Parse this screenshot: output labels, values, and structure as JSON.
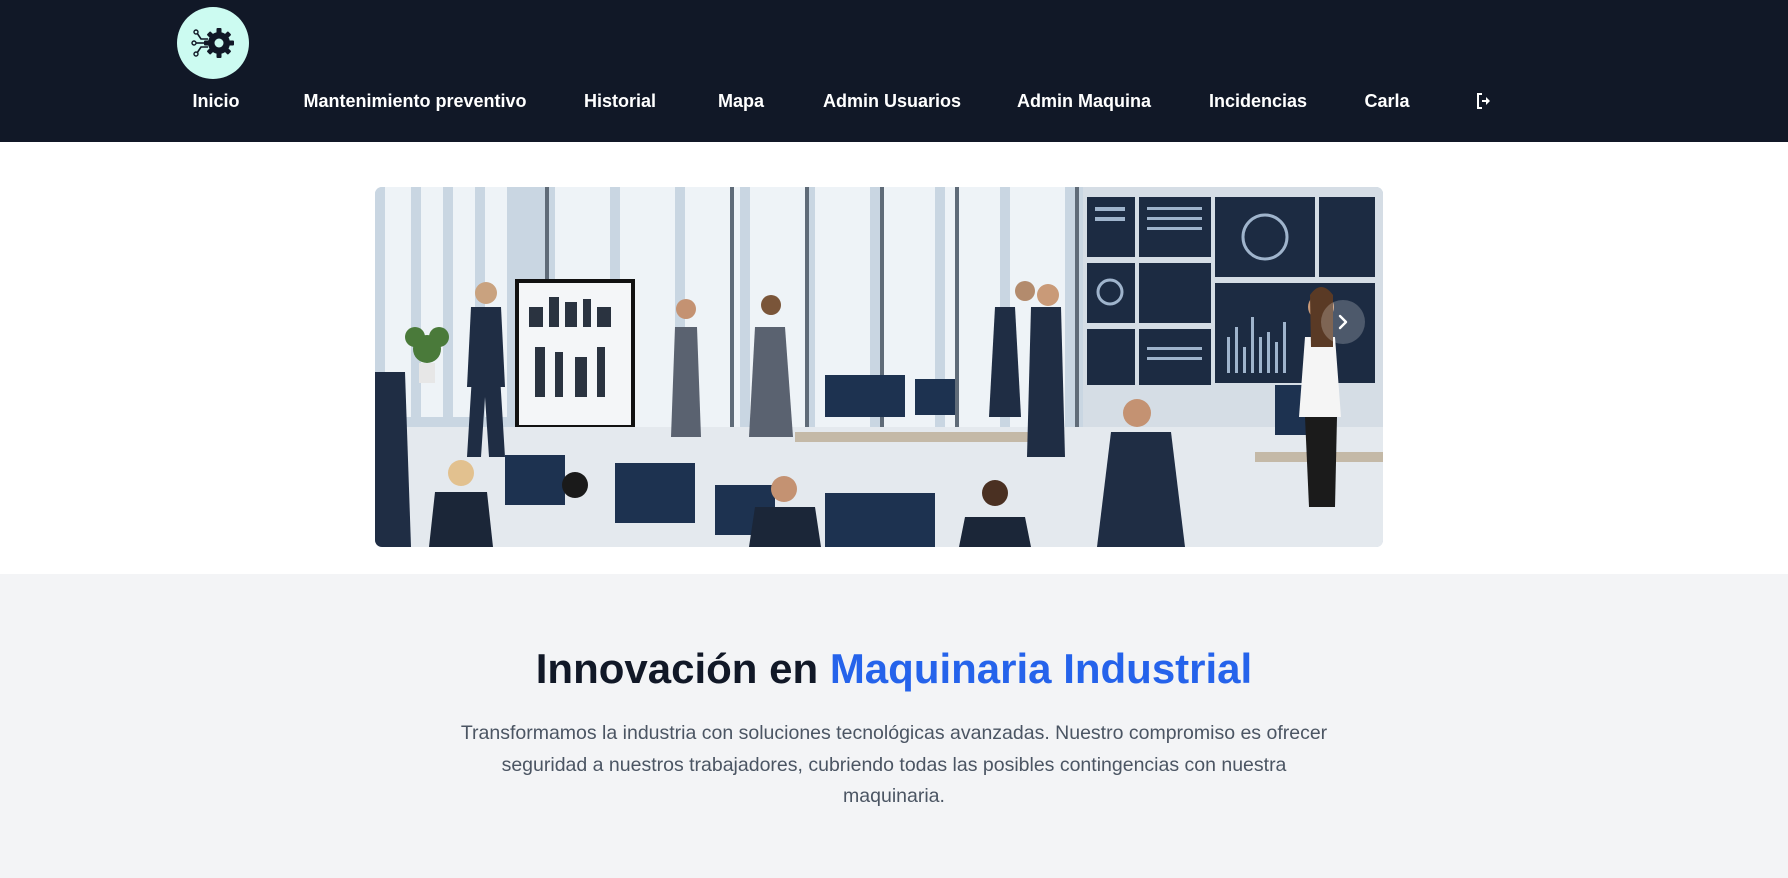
{
  "nav": {
    "items": [
      {
        "label": "Inicio"
      },
      {
        "label": "Mantenimiento preventivo"
      },
      {
        "label": "Historial"
      },
      {
        "label": "Mapa"
      },
      {
        "label": "Admin Usuarios"
      },
      {
        "label": "Admin Maquina"
      },
      {
        "label": "Incidencias"
      },
      {
        "label": "Carla"
      }
    ],
    "logo_icon": "gear-circuit-icon",
    "logout_icon": "logout-icon"
  },
  "carousel": {
    "image": "office-team-monitoring-dashboards-image",
    "next_icon": "chevron-right-icon"
  },
  "intro": {
    "title_part1": "Innovación en ",
    "title_accent": "Maquinaria Industrial",
    "text": "Transformamos la industria con soluciones tecnológicas avanzadas. Nuestro compromiso es ofrecer seguridad a nuestros trabajadores, cubriendo todas las posibles contingencias con nuestra maquinaria."
  },
  "colors": {
    "navbar": "#111827",
    "accent": "#2563eb",
    "logo_bg": "#ccfbf1",
    "section_bg": "#f3f4f6"
  }
}
